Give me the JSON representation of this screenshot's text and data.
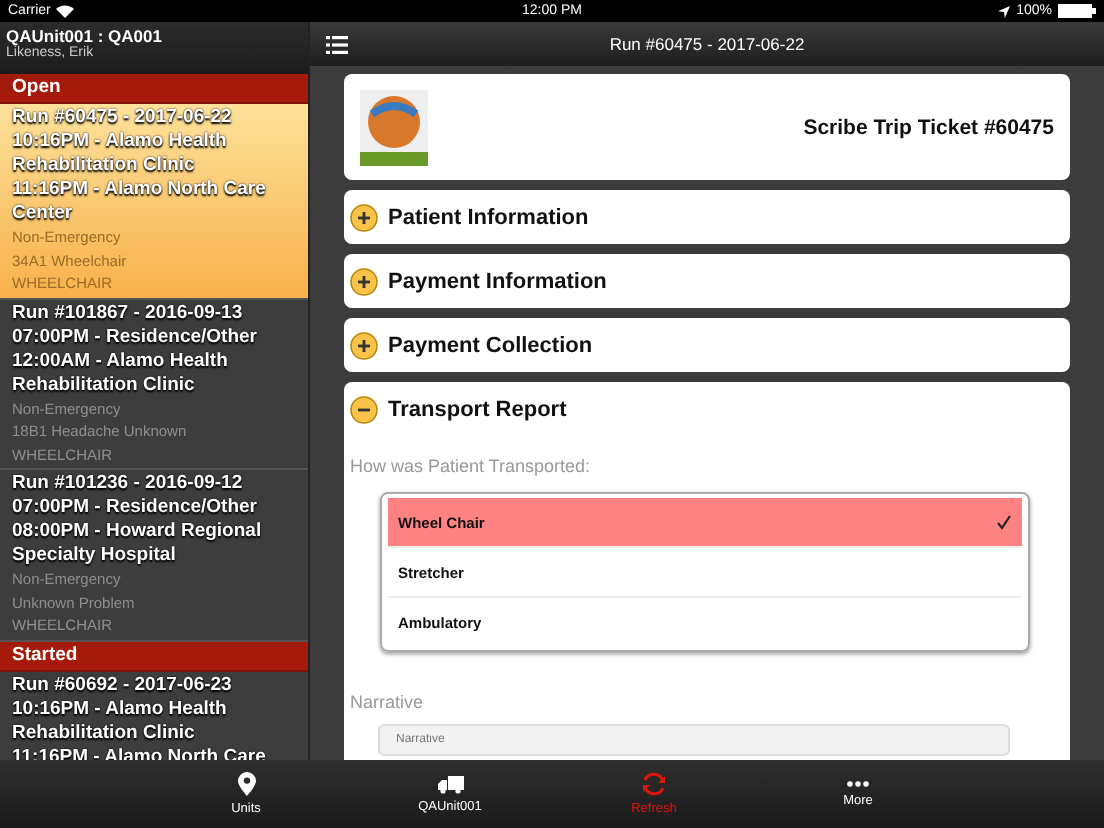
{
  "status_bar": {
    "carrier": "Carrier",
    "time": "12:00 PM",
    "battery": "100%"
  },
  "sidebar": {
    "unit": "QAUnit001 : QA001",
    "user": "Likeness, Erik",
    "groups": [
      {
        "label": "Open",
        "runs": [
          {
            "title": "Run #60475 - 2017-06-22",
            "pickup": "10:16PM - Alamo Health Rehabilitation Clinic",
            "dropoff": "11:16PM - Alamo North Care Center",
            "priority": "Non-Emergency",
            "complaint": "34A1 Wheelchair",
            "mode": "WHEELCHAIR",
            "selected": true
          },
          {
            "title": "Run #101867 - 2016-09-13",
            "pickup": "07:00PM - Residence/Other",
            "dropoff": "12:00AM - Alamo Health Rehabilitation Clinic",
            "priority": "Non-Emergency",
            "complaint": "18B1 Headache Unknown",
            "mode": "WHEELCHAIR",
            "selected": false
          },
          {
            "title": "Run #101236 - 2016-09-12",
            "pickup": "07:00PM - Residence/Other",
            "dropoff": "08:00PM - Howard Regional Specialty Hospital",
            "priority": "Non-Emergency",
            "complaint": "Unknown Problem",
            "mode": "WHEELCHAIR",
            "selected": false
          }
        ]
      },
      {
        "label": "Started",
        "runs": [
          {
            "title": "Run #60692 - 2017-06-23",
            "pickup": "10:16PM - Alamo Health Rehabilitation Clinic",
            "dropoff": "11:16PM - Alamo North Care",
            "selected": false
          }
        ]
      }
    ]
  },
  "nav_bar": {
    "title": "Run #60475 - 2017-06-22"
  },
  "ticket": {
    "title": "Scribe Trip Ticket #60475"
  },
  "sections": [
    {
      "title": "Patient Information",
      "expanded": false
    },
    {
      "title": "Payment Information",
      "expanded": false
    },
    {
      "title": "Payment Collection",
      "expanded": false
    },
    {
      "title": "Transport Report",
      "expanded": true
    }
  ],
  "transport_report": {
    "question": "How was Patient Transported:",
    "options": [
      {
        "label": "Wheel Chair",
        "selected": true
      },
      {
        "label": "Stretcher",
        "selected": false
      },
      {
        "label": "Ambulatory",
        "selected": false
      }
    ],
    "narrative_label": "Narrative",
    "narrative_placeholder": "Narrative"
  },
  "tab_bar": [
    {
      "kind": "pin",
      "label": "Units",
      "selected": false
    },
    {
      "kind": "truck",
      "label": "QAUnit001",
      "selected": false
    },
    {
      "kind": "refresh",
      "label": "Refresh",
      "selected": true
    },
    {
      "kind": "more",
      "label": "More",
      "selected": false
    }
  ]
}
